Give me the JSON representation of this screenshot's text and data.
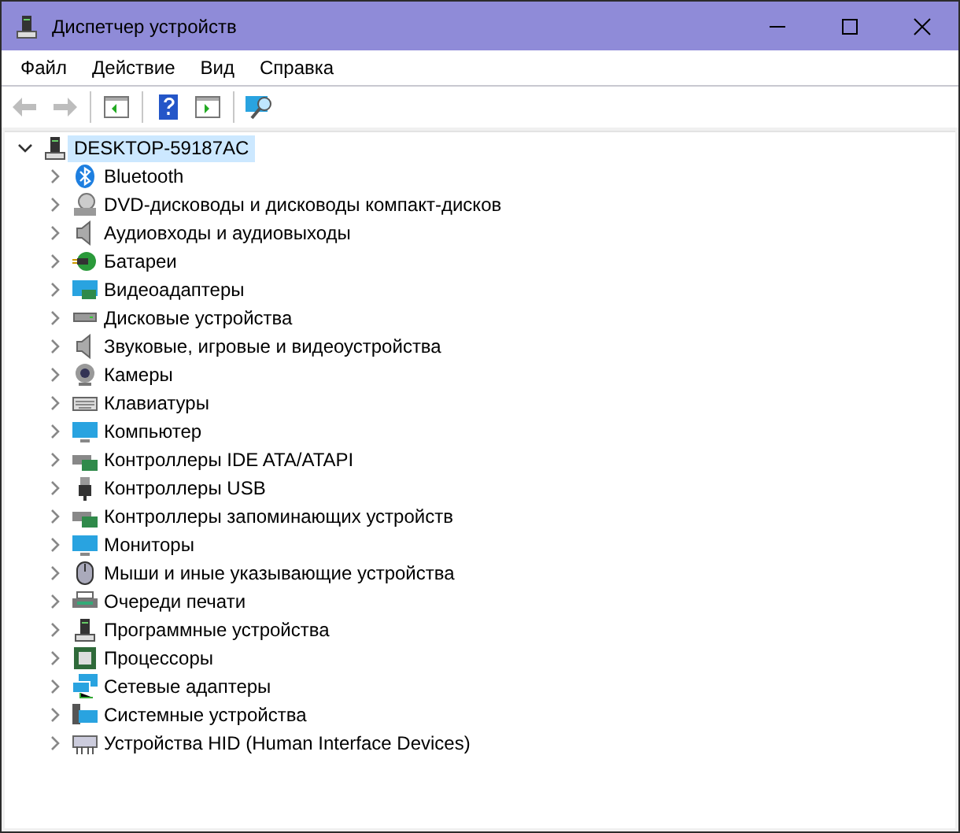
{
  "window": {
    "title": "Диспетчер устройств"
  },
  "menu": [
    "Файл",
    "Действие",
    "Вид",
    "Справка"
  ],
  "toolbar": [
    {
      "kind": "back",
      "disabled": true
    },
    {
      "kind": "forward",
      "disabled": true
    },
    {
      "kind": "separator"
    },
    {
      "kind": "panel-left",
      "disabled": false
    },
    {
      "kind": "separator"
    },
    {
      "kind": "help",
      "disabled": false
    },
    {
      "kind": "panel-right",
      "disabled": false
    },
    {
      "kind": "separator"
    },
    {
      "kind": "scan",
      "disabled": false
    }
  ],
  "tree": {
    "label": "DESKTOP-59187AC",
    "kind": "computer-tower",
    "expanded": true,
    "selected": true,
    "children": [
      {
        "label": "Bluetooth",
        "kind": "bluetooth",
        "expanded": false
      },
      {
        "label": "DVD-дисководы и дисководы компакт-дисков",
        "kind": "dvd",
        "expanded": false
      },
      {
        "label": "Аудиовходы и аудиовыходы",
        "kind": "speaker",
        "expanded": false
      },
      {
        "label": "Батареи",
        "kind": "battery",
        "expanded": false
      },
      {
        "label": "Видеоадаптеры",
        "kind": "display-card",
        "expanded": false
      },
      {
        "label": "Дисковые устройства",
        "kind": "disk",
        "expanded": false
      },
      {
        "label": "Звуковые, игровые и видеоустройства",
        "kind": "speaker",
        "expanded": false
      },
      {
        "label": "Камеры",
        "kind": "camera",
        "expanded": false
      },
      {
        "label": "Клавиатуры",
        "kind": "keyboard",
        "expanded": false
      },
      {
        "label": "Компьютер",
        "kind": "monitor",
        "expanded": false
      },
      {
        "label": "Контроллеры IDE ATA/ATAPI",
        "kind": "controller",
        "expanded": false
      },
      {
        "label": "Контроллеры USB",
        "kind": "usb",
        "expanded": false
      },
      {
        "label": "Контроллеры запоминающих устройств",
        "kind": "controller",
        "expanded": false
      },
      {
        "label": "Мониторы",
        "kind": "monitor",
        "expanded": false
      },
      {
        "label": "Мыши и иные указывающие устройства",
        "kind": "mouse",
        "expanded": false
      },
      {
        "label": "Очереди печати",
        "kind": "printer",
        "expanded": false
      },
      {
        "label": "Программные устройства",
        "kind": "computer-tower",
        "expanded": false
      },
      {
        "label": "Процессоры",
        "kind": "chip",
        "expanded": false
      },
      {
        "label": "Сетевые адаптеры",
        "kind": "network",
        "expanded": false
      },
      {
        "label": "Системные устройства",
        "kind": "system",
        "expanded": false
      },
      {
        "label": "Устройства HID (Human Interface Devices)",
        "kind": "hid",
        "expanded": false
      }
    ]
  }
}
